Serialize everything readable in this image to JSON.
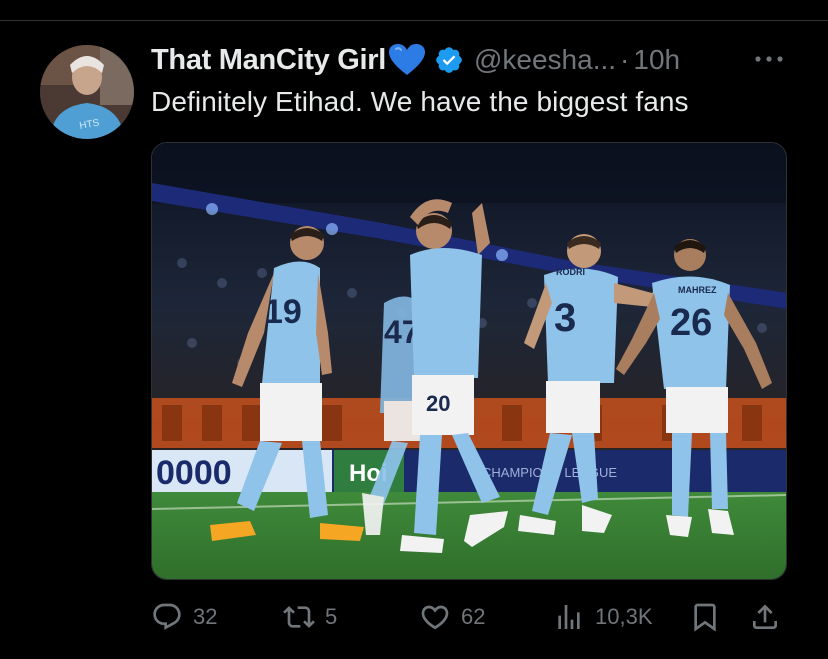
{
  "tweet": {
    "display_name": "That ManCity Girl",
    "name_emoji": "blue-heart",
    "handle": "@keesha...",
    "separator": "·",
    "time": "10h",
    "text": "Definitely Etihad. We have the biggest fans",
    "more_icon": "more-dots-icon"
  },
  "media": {
    "banner_left": "0000",
    "banner_mid": "Hoi",
    "banner_right": "CHAMPIONS LEAGUE",
    "players": [
      {
        "number": "19"
      },
      {
        "number": "47"
      },
      {
        "number": "20"
      },
      {
        "number": "3",
        "name": "RODRI"
      },
      {
        "number": "26",
        "name": "MAHREZ"
      }
    ]
  },
  "actions": {
    "reply_count": "32",
    "repost_count": "5",
    "like_count": "62",
    "views_count": "10,3K"
  },
  "colors": {
    "background": "#000000",
    "text": "#e7e9ea",
    "muted": "#71767b",
    "verified_blue": "#1d9bf0",
    "city_blue": "#8fc3ea"
  }
}
